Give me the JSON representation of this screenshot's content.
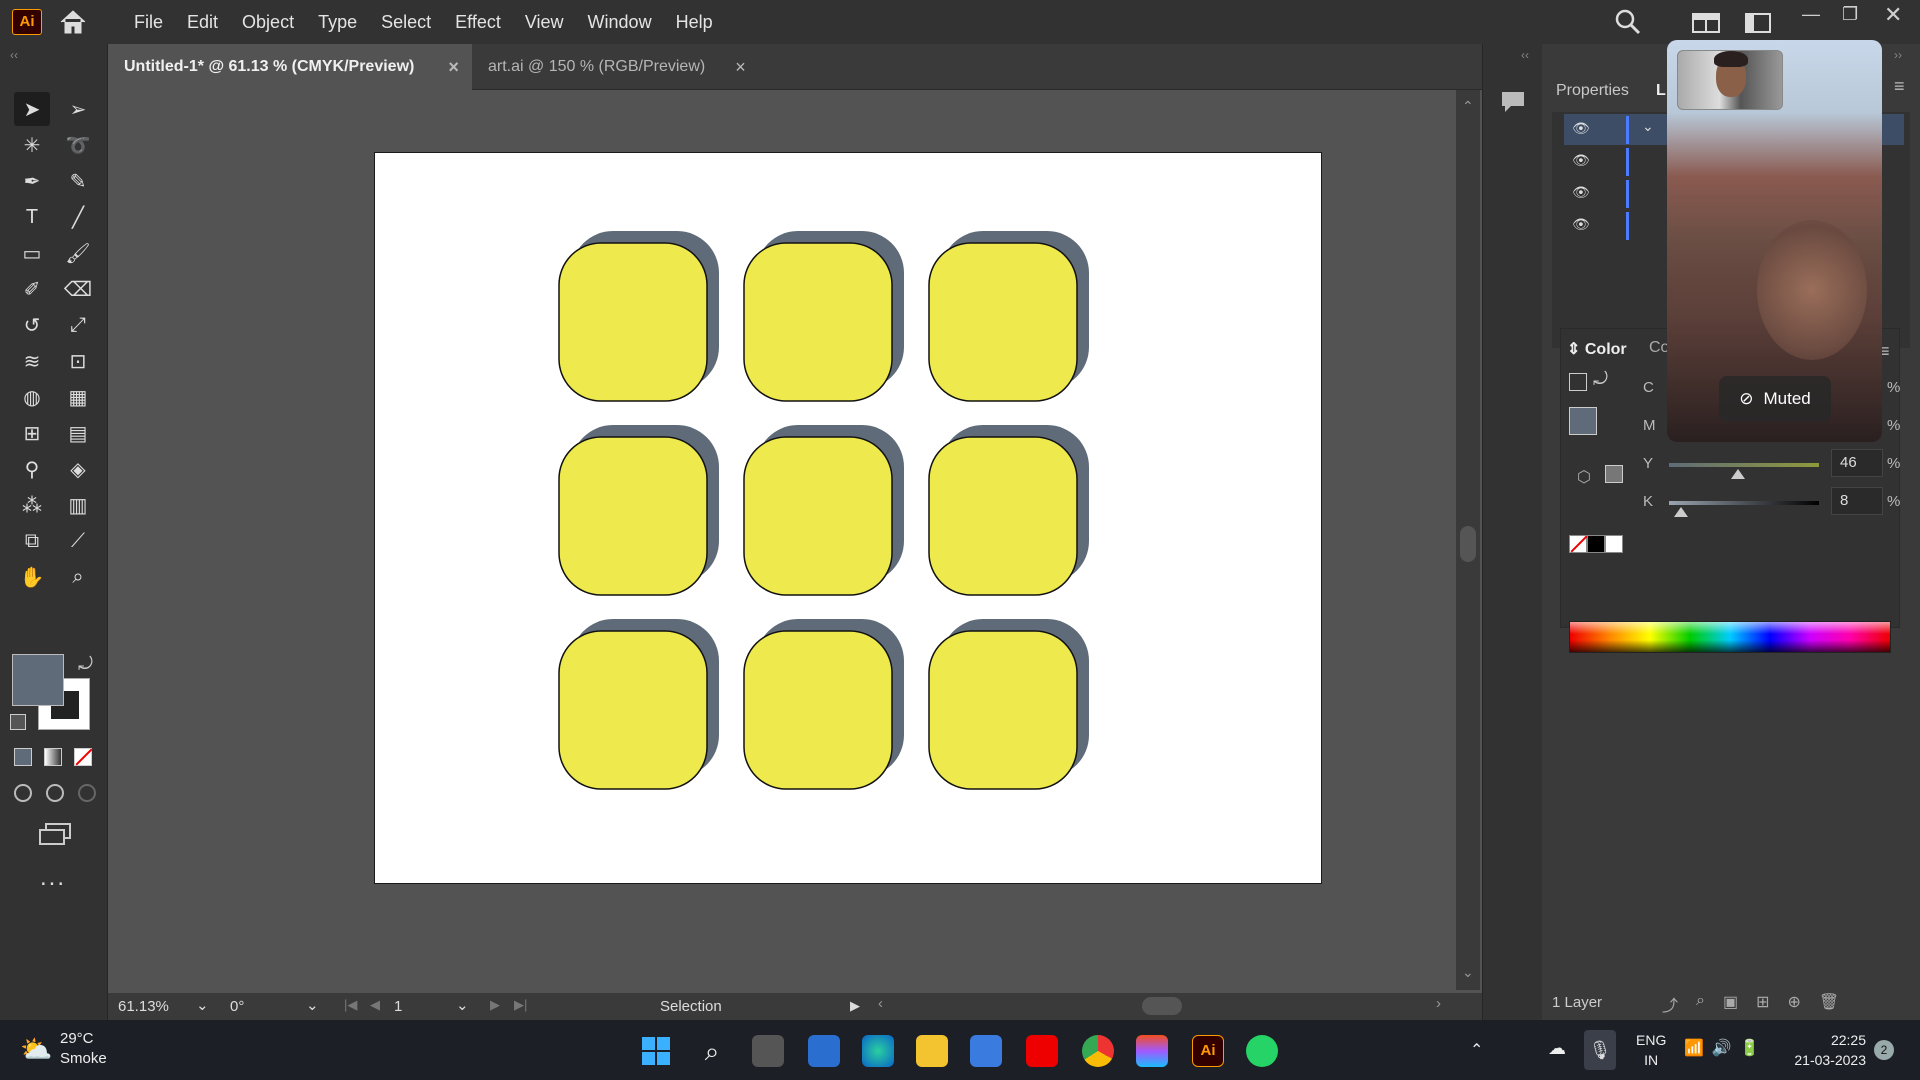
{
  "app": {
    "logo": "Ai",
    "brand_color": "#ff9a00"
  },
  "menu": [
    "File",
    "Edit",
    "Object",
    "Type",
    "Select",
    "Effect",
    "View",
    "Window",
    "Help"
  ],
  "tabs": [
    {
      "label": "Untitled-1* @ 61.13 % (CMYK/Preview)",
      "active": true
    },
    {
      "label": "art.ai @ 150 % (RGB/Preview)",
      "active": false
    }
  ],
  "tab_close": "×",
  "status": {
    "zoom": "61.13%",
    "rotation": "0°",
    "artboard": "1",
    "tool": "Selection"
  },
  "right_panel": {
    "tabs": [
      "Properties",
      "L"
    ],
    "layers_count": "1 Layer",
    "color": {
      "title": "Color",
      "tab2": "Co",
      "labels": [
        "C",
        "M",
        "Y",
        "K"
      ],
      "Y": "46",
      "K": "8",
      "percent": "%",
      "Y_level": 0.46,
      "K_level": 0.08
    }
  },
  "video_call": {
    "status": "Muted"
  },
  "shapes": {
    "fill": "#eeea4e",
    "shadow": "#5f6b78",
    "rows": 3,
    "cols": 3
  },
  "colors": {
    "fill_swatch": "#5f6b78"
  },
  "taskbar": {
    "weather_temp": "29°C",
    "weather_desc": "Smoke",
    "lang": "ENG",
    "region": "IN",
    "time": "22:25",
    "date": "21-03-2023",
    "notif": "2"
  },
  "more_tools": "..."
}
